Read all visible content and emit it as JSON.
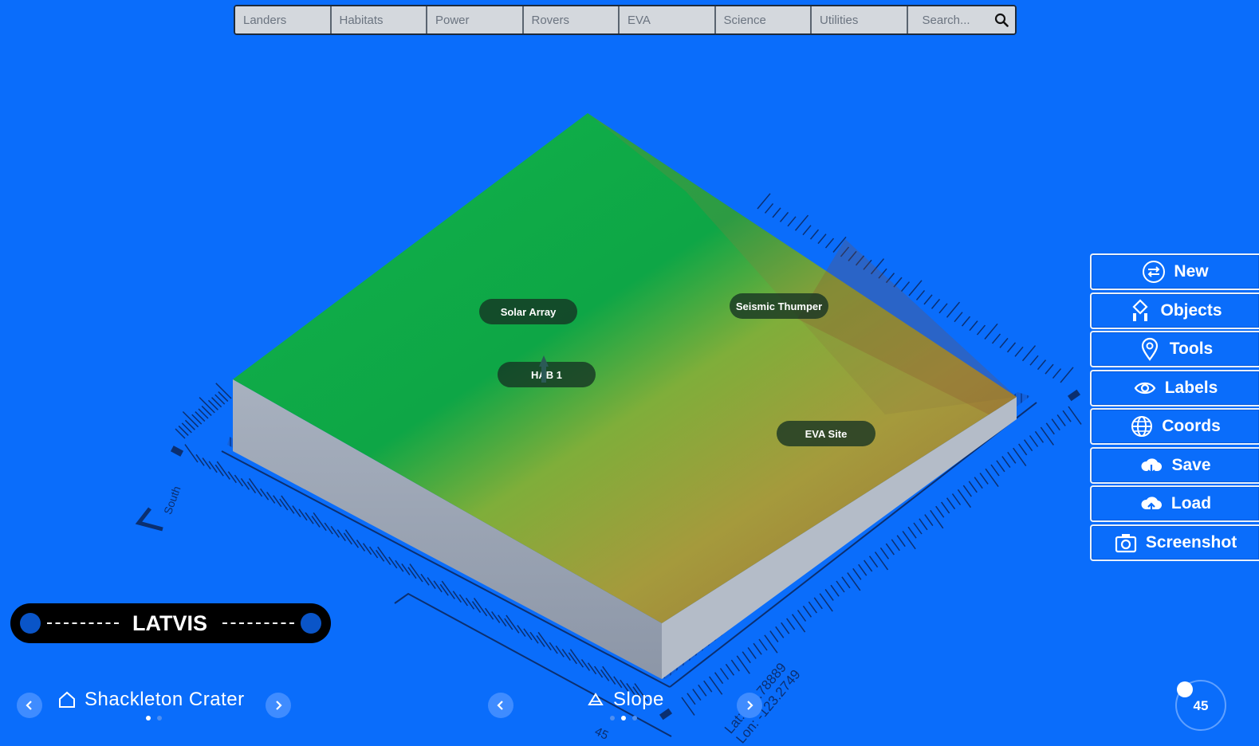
{
  "menu": {
    "items": [
      "Landers",
      "Habitats",
      "Power",
      "Rovers",
      "EVA",
      "Science",
      "Utilities"
    ],
    "search_placeholder": "Search..."
  },
  "map_labels": {
    "solar_array": "Solar Array",
    "seismic_thumper": "Seismic Thumper",
    "hab1": "HAB 1",
    "eva_site": "EVA Site"
  },
  "side_panel": {
    "new": "New",
    "objects": "Objects",
    "tools": "Tools",
    "labels": "Labels",
    "coords": "Coords",
    "save": "Save",
    "load": "Load",
    "screenshot": "Screenshot"
  },
  "logo": {
    "text": "LATVIS"
  },
  "location": {
    "name": "Shackleton Crater",
    "page_count": 2,
    "active_page": 0
  },
  "layer": {
    "name": "Slope",
    "page_count": 3,
    "active_page": 1
  },
  "compass": {
    "label": "South"
  },
  "coords": {
    "lat": "Lat: -88.78889",
    "lon": "Lon: -123.2749",
    "extra": "45"
  },
  "zoom": {
    "value": "45"
  },
  "colors": {
    "background": "#0a6dfb",
    "accent": "#3f8cff"
  }
}
